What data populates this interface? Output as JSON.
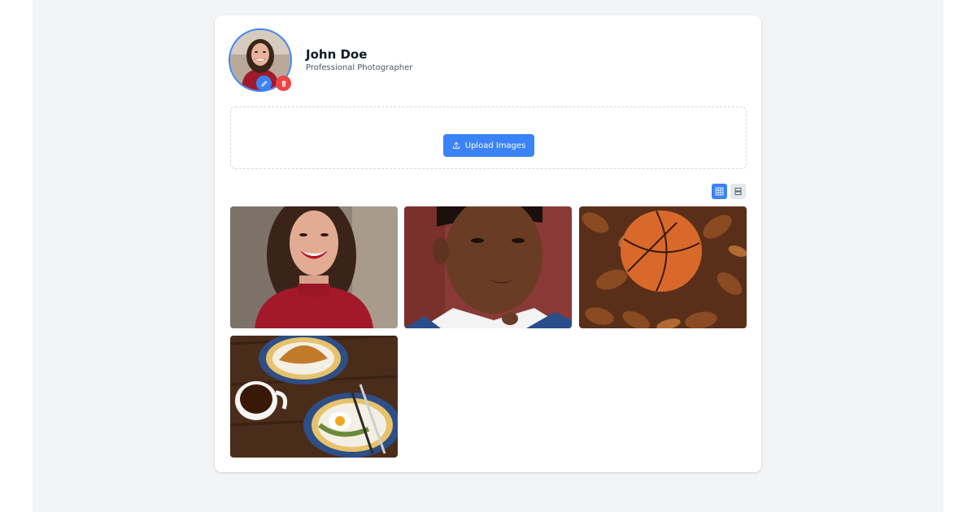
{
  "profile": {
    "name": "John Doe",
    "title": "Professional Photographer",
    "avatar_icon": "avatar-photo"
  },
  "avatar_actions": {
    "edit_icon": "pencil-icon",
    "delete_icon": "trash-icon"
  },
  "upload": {
    "label": "Upload Images",
    "icon": "upload-icon"
  },
  "view_modes": [
    {
      "name": "grid",
      "icon": "grid-icon",
      "active": true
    },
    {
      "name": "list",
      "icon": "list-icon",
      "active": false
    }
  ],
  "gallery": {
    "images": [
      {
        "name": "woman-red-sweater-photo"
      },
      {
        "name": "portrait-woman-photo"
      },
      {
        "name": "basketball-leaves-photo"
      },
      {
        "name": "breakfast-table-photo"
      }
    ]
  },
  "colors": {
    "accent": "#3b82f6",
    "danger": "#ef4444",
    "page_bg": "#f3f4f6",
    "card_bg": "#ffffff"
  }
}
